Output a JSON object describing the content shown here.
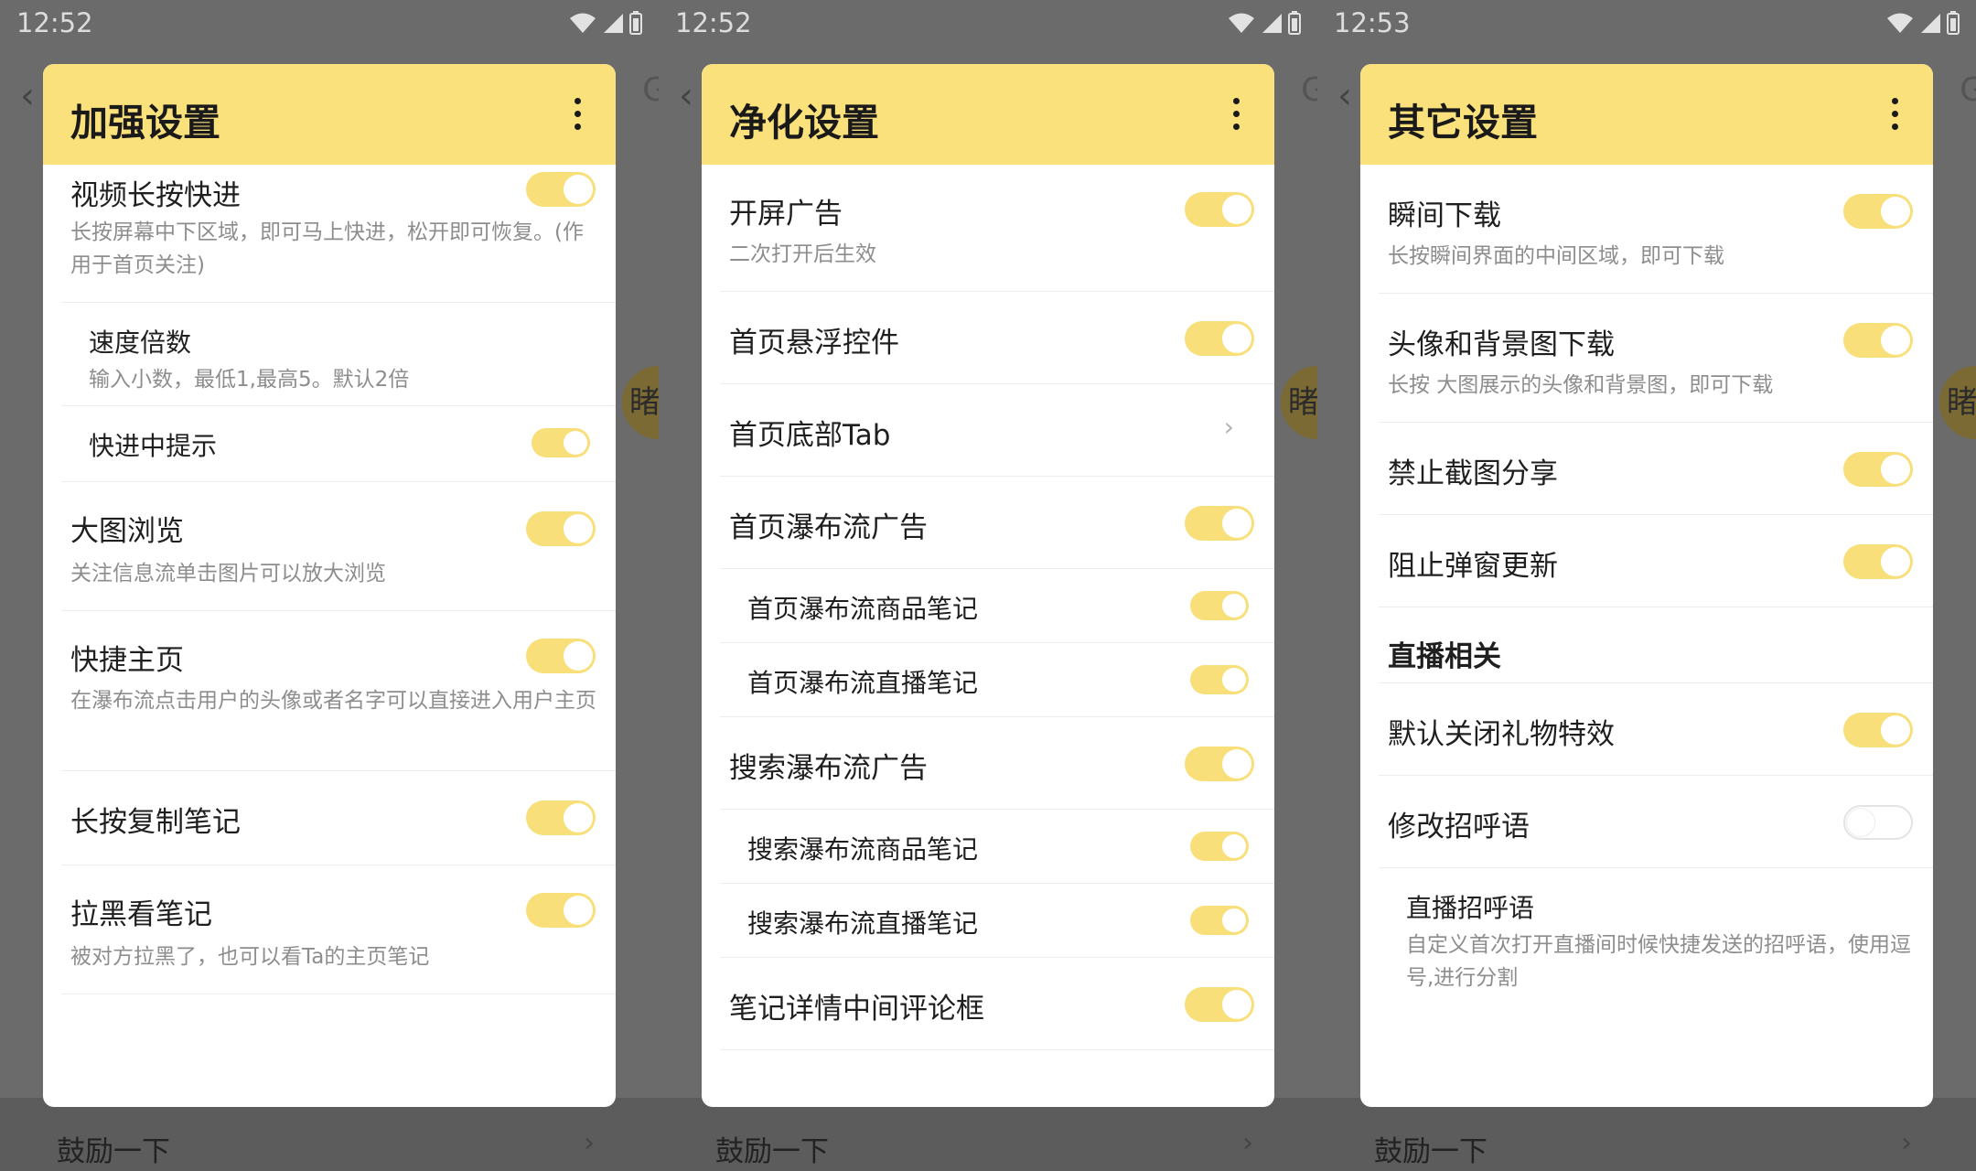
{
  "statusbar_times": [
    "12:52",
    "12:52",
    "12:53"
  ],
  "background": {
    "footer_label": "鼓励一下",
    "badge_char": "睹"
  },
  "panels": [
    {
      "title": "加强设置",
      "items": [
        {
          "title": "视频长按快进",
          "desc": "长按屏幕中下区域，即可马上快进，松开即可恢复。(作用于首页关注)",
          "toggle": "on"
        },
        {
          "title": "速度倍数",
          "desc": "输入小数，最低1,最高5。默认2倍"
        },
        {
          "title": "快进中提示",
          "toggle": "on"
        },
        {
          "title": "大图浏览",
          "desc": "关注信息流单击图片可以放大浏览",
          "toggle": "on"
        },
        {
          "title": "快捷主页",
          "desc": "在瀑布流点击用户的头像或者名字可以直接进入用户主页",
          "toggle": "on"
        },
        {
          "title": "长按复制笔记",
          "toggle": "on"
        },
        {
          "title": "拉黑看笔记",
          "desc": "被对方拉黑了，也可以看Ta的主页笔记",
          "toggle": "on"
        }
      ]
    },
    {
      "title": "净化设置",
      "items": [
        {
          "title": "开屏广告",
          "desc": "二次打开后生效",
          "toggle": "on"
        },
        {
          "title": "首页悬浮控件",
          "toggle": "on"
        },
        {
          "title": "首页底部Tab",
          "chevron": "›"
        },
        {
          "title": "首页瀑布流广告",
          "toggle": "on"
        },
        {
          "title": "首页瀑布流商品笔记",
          "toggle": "on"
        },
        {
          "title": "首页瀑布流直播笔记",
          "toggle": "on"
        },
        {
          "title": "搜索瀑布流广告",
          "toggle": "on"
        },
        {
          "title": "搜索瀑布流商品笔记",
          "toggle": "on"
        },
        {
          "title": "搜索瀑布流直播笔记",
          "toggle": "on"
        },
        {
          "title": "笔记详情中间评论框",
          "toggle": "on"
        }
      ]
    },
    {
      "title": "其它设置",
      "items": [
        {
          "title": "瞬间下载",
          "desc": "长按瞬间界面的中间区域，即可下载",
          "toggle": "on"
        },
        {
          "title": "头像和背景图下载",
          "desc": "长按 大图展示的头像和背景图，即可下载",
          "toggle": "on"
        },
        {
          "title": "禁止截图分享",
          "toggle": "on"
        },
        {
          "title": "阻止弹窗更新",
          "toggle": "on"
        },
        {
          "section": "直播相关"
        },
        {
          "title": "默认关闭礼物特效",
          "toggle": "on"
        },
        {
          "title": "修改招呼语",
          "toggle": "off"
        },
        {
          "title": "直播招呼语",
          "desc": "自定义首次打开直播间时候快捷发送的招呼语，使用逗号,进行分割"
        }
      ]
    }
  ]
}
